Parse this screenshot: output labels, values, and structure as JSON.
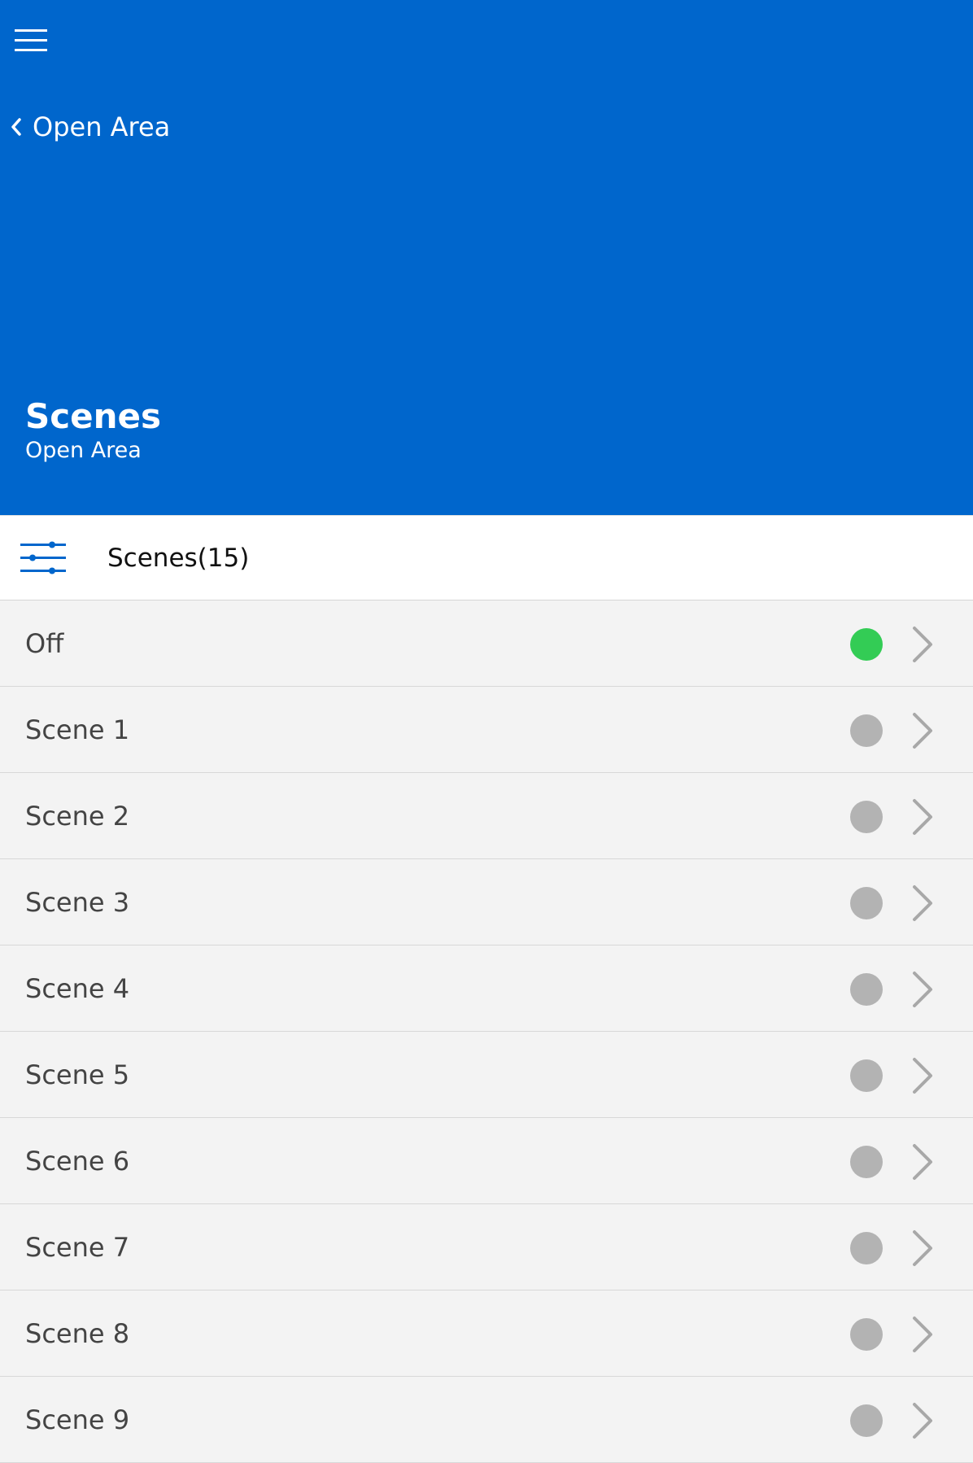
{
  "header": {
    "back_label": "Open Area",
    "title": "Scenes",
    "subtitle": "Open Area",
    "background_color": "#0066cc"
  },
  "filter_bar": {
    "label": "Scenes(15)",
    "icon": "sliders-icon",
    "icon_color": "#0066cc"
  },
  "status_colors": {
    "active": "#33cc55",
    "inactive": "#b3b3b3"
  },
  "scenes": [
    {
      "label": "Off",
      "active": true
    },
    {
      "label": "Scene 1",
      "active": false
    },
    {
      "label": "Scene 2",
      "active": false
    },
    {
      "label": "Scene 3",
      "active": false
    },
    {
      "label": "Scene 4",
      "active": false
    },
    {
      "label": "Scene 5",
      "active": false
    },
    {
      "label": "Scene 6",
      "active": false
    },
    {
      "label": "Scene 7",
      "active": false
    },
    {
      "label": "Scene 8",
      "active": false
    },
    {
      "label": "Scene 9",
      "active": false
    }
  ]
}
